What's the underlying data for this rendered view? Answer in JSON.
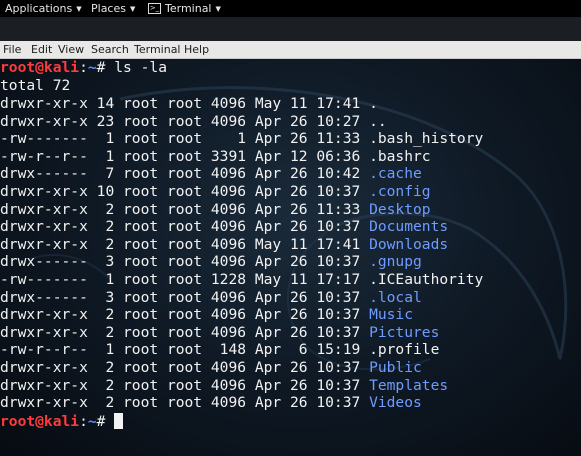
{
  "top_panel": {
    "applications": "Applications",
    "places": "Places",
    "terminal": "Terminal"
  },
  "menubar": [
    "File",
    "Edit",
    "View",
    "Search",
    "Terminal",
    "Help"
  ],
  "terminal": {
    "prompt_user": "root@kali",
    "prompt_sep": ":",
    "prompt_path": "~",
    "prompt_symbol": "#",
    "command": "ls -la",
    "total": "total 72",
    "entries": [
      {
        "perms": "drwxr-xr-x",
        "links": "14",
        "owner": "root",
        "group": "root",
        "size": "4096",
        "month": "May",
        "day": "11",
        "time": "17:41",
        "name": ".",
        "blue": false
      },
      {
        "perms": "drwxr-xr-x",
        "links": "23",
        "owner": "root",
        "group": "root",
        "size": "4096",
        "month": "Apr",
        "day": "26",
        "time": "10:27",
        "name": "..",
        "blue": false
      },
      {
        "perms": "-rw-------",
        "links": "1",
        "owner": "root",
        "group": "root",
        "size": "1",
        "month": "Apr",
        "day": "26",
        "time": "11:33",
        "name": ".bash_history",
        "blue": false
      },
      {
        "perms": "-rw-r--r--",
        "links": "1",
        "owner": "root",
        "group": "root",
        "size": "3391",
        "month": "Apr",
        "day": "12",
        "time": "06:36",
        "name": ".bashrc",
        "blue": false
      },
      {
        "perms": "drwx------",
        "links": "7",
        "owner": "root",
        "group": "root",
        "size": "4096",
        "month": "Apr",
        "day": "26",
        "time": "10:42",
        "name": ".cache",
        "blue": true
      },
      {
        "perms": "drwxr-xr-x",
        "links": "10",
        "owner": "root",
        "group": "root",
        "size": "4096",
        "month": "Apr",
        "day": "26",
        "time": "10:37",
        "name": ".config",
        "blue": true
      },
      {
        "perms": "drwxr-xr-x",
        "links": "2",
        "owner": "root",
        "group": "root",
        "size": "4096",
        "month": "Apr",
        "day": "26",
        "time": "11:33",
        "name": "Desktop",
        "blue": true
      },
      {
        "perms": "drwxr-xr-x",
        "links": "2",
        "owner": "root",
        "group": "root",
        "size": "4096",
        "month": "Apr",
        "day": "26",
        "time": "10:37",
        "name": "Documents",
        "blue": true
      },
      {
        "perms": "drwxr-xr-x",
        "links": "2",
        "owner": "root",
        "group": "root",
        "size": "4096",
        "month": "May",
        "day": "11",
        "time": "17:41",
        "name": "Downloads",
        "blue": true
      },
      {
        "perms": "drwx------",
        "links": "3",
        "owner": "root",
        "group": "root",
        "size": "4096",
        "month": "Apr",
        "day": "26",
        "time": "10:37",
        "name": ".gnupg",
        "blue": true
      },
      {
        "perms": "-rw-------",
        "links": "1",
        "owner": "root",
        "group": "root",
        "size": "1228",
        "month": "May",
        "day": "11",
        "time": "17:17",
        "name": ".ICEauthority",
        "blue": false
      },
      {
        "perms": "drwx------",
        "links": "3",
        "owner": "root",
        "group": "root",
        "size": "4096",
        "month": "Apr",
        "day": "26",
        "time": "10:37",
        "name": ".local",
        "blue": true
      },
      {
        "perms": "drwxr-xr-x",
        "links": "2",
        "owner": "root",
        "group": "root",
        "size": "4096",
        "month": "Apr",
        "day": "26",
        "time": "10:37",
        "name": "Music",
        "blue": true
      },
      {
        "perms": "drwxr-xr-x",
        "links": "2",
        "owner": "root",
        "group": "root",
        "size": "4096",
        "month": "Apr",
        "day": "26",
        "time": "10:37",
        "name": "Pictures",
        "blue": true
      },
      {
        "perms": "-rw-r--r--",
        "links": "1",
        "owner": "root",
        "group": "root",
        "size": "148",
        "month": "Apr",
        "day": "6",
        "time": "15:19",
        "name": ".profile",
        "blue": false
      },
      {
        "perms": "drwxr-xr-x",
        "links": "2",
        "owner": "root",
        "group": "root",
        "size": "4096",
        "month": "Apr",
        "day": "26",
        "time": "10:37",
        "name": "Public",
        "blue": true
      },
      {
        "perms": "drwxr-xr-x",
        "links": "2",
        "owner": "root",
        "group": "root",
        "size": "4096",
        "month": "Apr",
        "day": "26",
        "time": "10:37",
        "name": "Templates",
        "blue": true
      },
      {
        "perms": "drwxr-xr-x",
        "links": "2",
        "owner": "root",
        "group": "root",
        "size": "4096",
        "month": "Apr",
        "day": "26",
        "time": "10:37",
        "name": "Videos",
        "blue": true
      }
    ]
  },
  "colors": {
    "prompt_user": "#ff3b3b",
    "prompt_path": "#5b8cff",
    "directory": "#6e9cff",
    "text": "#f2f2f2"
  }
}
